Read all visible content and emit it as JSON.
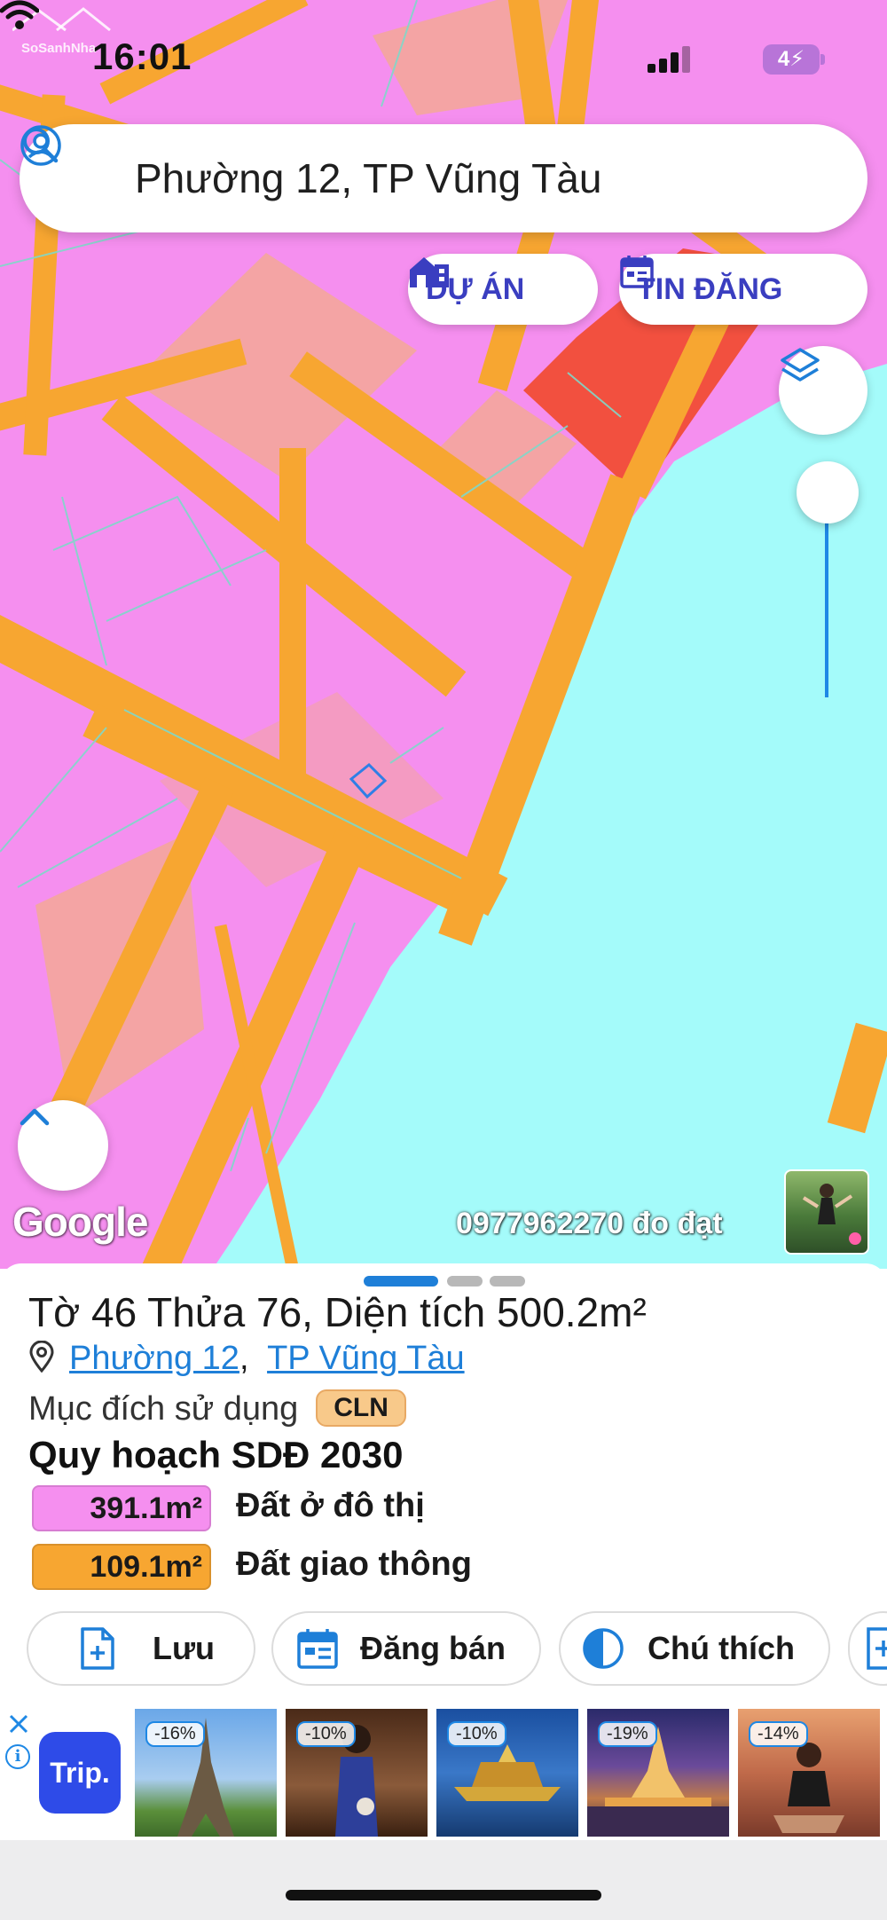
{
  "status_bar": {
    "time": "16:01",
    "battery": "4⚡"
  },
  "watermark": {
    "text": "SoSanhNha"
  },
  "search": {
    "location_text": "Phường 12, TP Vũng Tàu"
  },
  "map_buttons": {
    "du_an": "DỰ ÁN",
    "tin_dang": "TIN ĐĂNG"
  },
  "map_attribution": {
    "google": "Google",
    "credit": "0977962270 đo đạt"
  },
  "parcel": {
    "title": "Tờ 46 Thửa 76, Diện tích 500.2m²",
    "ward": "Phường 12",
    "separator": ",",
    "city": "TP Vũng Tàu",
    "purpose_label": "Mục đích sử dụng",
    "purpose_code": "CLN",
    "plan_title": "Quy hoạch SDĐ 2030",
    "plan_items": [
      {
        "area": "391.1m²",
        "label": "Đất ở đô thị",
        "color": "#f58fef"
      },
      {
        "area": "109.1m²",
        "label": "Đất giao thông",
        "color": "#f7a631"
      }
    ]
  },
  "actions": {
    "save": "Lưu",
    "post_sale": "Đăng bán",
    "legend": "Chú thích"
  },
  "ad": {
    "brand": "Trip.",
    "discounts": [
      "-16%",
      "-10%",
      "-10%",
      "-19%",
      "-14%"
    ]
  },
  "colors": {
    "residential_pink": "#f58fef",
    "road_orange": "#f7a631",
    "water_cyan": "#a4fbfa",
    "commercial_red": "#f2503f",
    "accent_blue": "#1e7fd8",
    "button_text": "#3a3ec0"
  },
  "icons": [
    "user-icon",
    "search-icon",
    "building-icon",
    "calendar-icon",
    "layers-icon",
    "chevron-up-icon",
    "map-pin-icon",
    "file-plus-icon",
    "calendar-post-icon",
    "half-circle-icon",
    "close-icon",
    "info-icon"
  ]
}
